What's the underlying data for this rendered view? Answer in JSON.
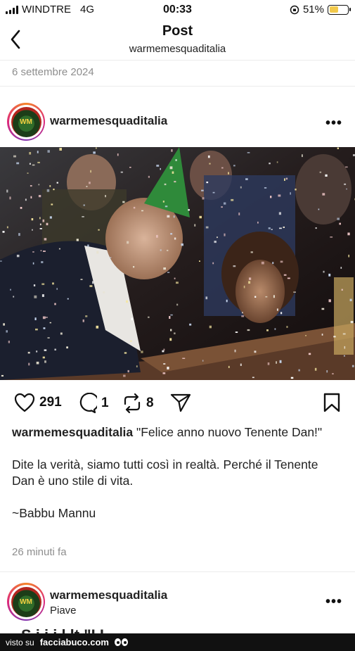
{
  "status_bar": {
    "carrier": "WINDTRE",
    "network": "4G",
    "time": "00:33",
    "battery": "51%",
    "battery_level": 0.51
  },
  "nav": {
    "title": "Post",
    "subtitle": "warmemesquaditalia"
  },
  "date": "6 settembre 2024",
  "post": {
    "username": "warmemesquaditalia",
    "avatar_text": "WM",
    "likes": "291",
    "comments": "1",
    "reposts": "8",
    "caption_user": "warmemesquaditalia",
    "caption_title": "\"Felice anno nuovo Tenente Dan!\"",
    "caption_body": "Dite la verità, siamo tutti così in realtà. Perché il Tenente Dan è uno stile di vita.",
    "caption_signature": "~Babbu Mannu",
    "time_ago": "26 minuti fa"
  },
  "next_post": {
    "username": "warmemesquaditalia",
    "avatar_text": "WM",
    "location": "Piave",
    "caption_start": "S    i  i  i      l      lt     \"I    I"
  },
  "footer": {
    "prefix": "visto su",
    "brand": "facciabuco.com"
  },
  "colors": {
    "muted": "#8e8e8e",
    "battery": "#f2c94c",
    "story_ring": "#dd2a7b"
  }
}
